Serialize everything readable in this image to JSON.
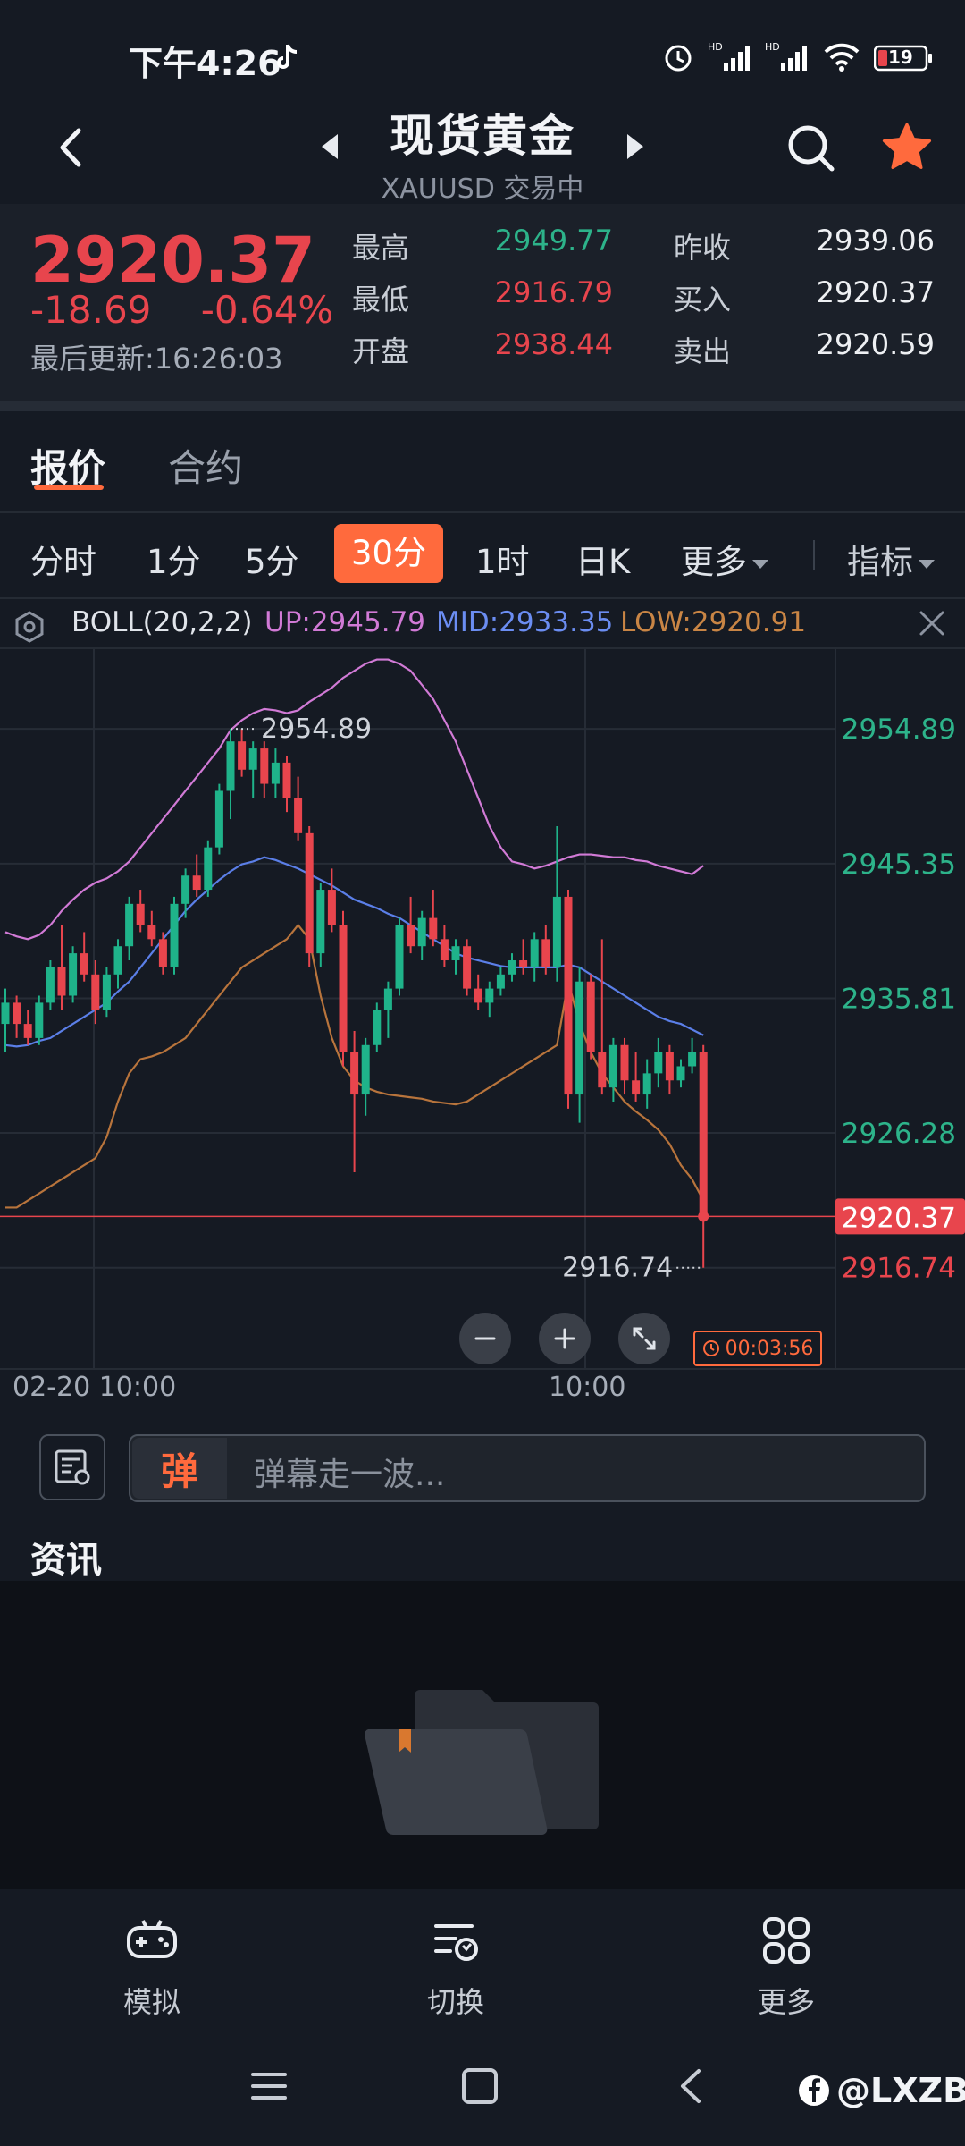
{
  "status_bar": {
    "time": "下午4:26",
    "battery": "19"
  },
  "header": {
    "title": "现货黄金",
    "subtitle": "XAUUSD 交易中"
  },
  "quote": {
    "price": "2920.37",
    "change": "-18.69",
    "change_pct": "-0.64%",
    "last_update": "最后更新:16:26:03",
    "high_label": "最高",
    "high": "2949.77",
    "low_label": "最低",
    "low": "2916.79",
    "open_label": "开盘",
    "open": "2938.44",
    "prev_close_label": "昨收",
    "prev_close": "2939.06",
    "buy_label": "买入",
    "buy": "2920.37",
    "sell_label": "卖出",
    "sell": "2920.59"
  },
  "tabs": [
    "报价",
    "合约"
  ],
  "periods": [
    "分时",
    "1分",
    "5分",
    "30分",
    "1时",
    "日K",
    "更多"
  ],
  "active_period": "30分",
  "indicator_menu": "指标",
  "indicator": {
    "name": "BOLL(20,2,2)",
    "up": "UP:2945.79",
    "mid": "MID:2933.35",
    "low": "LOW:2920.91"
  },
  "chart_data": {
    "type": "candlestick",
    "y_ticks": [
      "2954.89",
      "2945.35",
      "2935.81",
      "2926.28",
      "2916.74"
    ],
    "current_price_tag": "2920.37",
    "max_annotation": "2954.89",
    "min_annotation": "2916.74",
    "x_labels": [
      "02-20 10:00",
      "10:00"
    ],
    "ylim": [
      2914,
      2958
    ],
    "timer": "00:03:56",
    "colors": {
      "up": "#e8454d",
      "down": "#1fb38a",
      "boll_up": "#d17ad6",
      "boll_mid": "#5b7fe8",
      "boll_low": "#b8743c"
    },
    "candles": [
      {
        "o": 2934.0,
        "h": 2936.5,
        "l": 2932.0,
        "c": 2935.5
      },
      {
        "o": 2935.5,
        "h": 2936.0,
        "l": 2933.0,
        "c": 2934.0
      },
      {
        "o": 2934.0,
        "h": 2935.0,
        "l": 2932.5,
        "c": 2933.0
      },
      {
        "o": 2933.0,
        "h": 2936.0,
        "l": 2932.5,
        "c": 2935.5
      },
      {
        "o": 2935.5,
        "h": 2938.5,
        "l": 2935.0,
        "c": 2938.0
      },
      {
        "o": 2938.0,
        "h": 2941.0,
        "l": 2935.0,
        "c": 2936.0
      },
      {
        "o": 2936.0,
        "h": 2939.5,
        "l": 2935.5,
        "c": 2939.0
      },
      {
        "o": 2939.0,
        "h": 2940.5,
        "l": 2937.0,
        "c": 2937.5
      },
      {
        "o": 2937.5,
        "h": 2938.5,
        "l": 2934.0,
        "c": 2935.0
      },
      {
        "o": 2935.0,
        "h": 2938.0,
        "l": 2934.5,
        "c": 2937.5
      },
      {
        "o": 2937.5,
        "h": 2940.0,
        "l": 2936.5,
        "c": 2939.5
      },
      {
        "o": 2939.5,
        "h": 2943.0,
        "l": 2938.5,
        "c": 2942.5
      },
      {
        "o": 2942.5,
        "h": 2943.5,
        "l": 2940.5,
        "c": 2941.0
      },
      {
        "o": 2941.0,
        "h": 2942.0,
        "l": 2939.5,
        "c": 2940.0
      },
      {
        "o": 2940.0,
        "h": 2940.5,
        "l": 2937.5,
        "c": 2938.0
      },
      {
        "o": 2938.0,
        "h": 2943.0,
        "l": 2937.5,
        "c": 2942.5
      },
      {
        "o": 2942.5,
        "h": 2945.0,
        "l": 2941.5,
        "c": 2944.5
      },
      {
        "o": 2944.5,
        "h": 2946.0,
        "l": 2943.0,
        "c": 2943.5
      },
      {
        "o": 2943.5,
        "h": 2947.0,
        "l": 2943.0,
        "c": 2946.5
      },
      {
        "o": 2946.5,
        "h": 2951.0,
        "l": 2946.0,
        "c": 2950.5
      },
      {
        "o": 2950.5,
        "h": 2954.89,
        "l": 2948.5,
        "c": 2954.0
      },
      {
        "o": 2954.0,
        "h": 2954.89,
        "l": 2951.5,
        "c": 2952.0
      },
      {
        "o": 2952.0,
        "h": 2954.0,
        "l": 2950.0,
        "c": 2953.5
      },
      {
        "o": 2953.5,
        "h": 2954.0,
        "l": 2950.0,
        "c": 2951.0
      },
      {
        "o": 2951.0,
        "h": 2953.5,
        "l": 2950.0,
        "c": 2952.5
      },
      {
        "o": 2952.5,
        "h": 2953.0,
        "l": 2949.0,
        "c": 2950.0
      },
      {
        "o": 2950.0,
        "h": 2951.5,
        "l": 2947.0,
        "c": 2947.5
      },
      {
        "o": 2947.5,
        "h": 2948.0,
        "l": 2938.0,
        "c": 2939.0
      },
      {
        "o": 2939.0,
        "h": 2944.0,
        "l": 2938.0,
        "c": 2943.5
      },
      {
        "o": 2943.5,
        "h": 2945.0,
        "l": 2940.5,
        "c": 2941.0
      },
      {
        "o": 2941.0,
        "h": 2942.0,
        "l": 2931.0,
        "c": 2932.0
      },
      {
        "o": 2932.0,
        "h": 2933.5,
        "l": 2923.5,
        "c": 2929.0
      },
      {
        "o": 2929.0,
        "h": 2933.0,
        "l": 2927.5,
        "c": 2932.5
      },
      {
        "o": 2932.5,
        "h": 2935.5,
        "l": 2932.0,
        "c": 2935.0
      },
      {
        "o": 2935.0,
        "h": 2937.0,
        "l": 2933.0,
        "c": 2936.5
      },
      {
        "o": 2936.5,
        "h": 2941.5,
        "l": 2936.0,
        "c": 2941.0
      },
      {
        "o": 2941.0,
        "h": 2943.0,
        "l": 2939.0,
        "c": 2939.5
      },
      {
        "o": 2939.5,
        "h": 2942.0,
        "l": 2938.5,
        "c": 2941.5
      },
      {
        "o": 2941.5,
        "h": 2943.5,
        "l": 2939.5,
        "c": 2940.0
      },
      {
        "o": 2940.0,
        "h": 2941.0,
        "l": 2938.0,
        "c": 2938.5
      },
      {
        "o": 2938.5,
        "h": 2940.0,
        "l": 2937.5,
        "c": 2939.5
      },
      {
        "o": 2939.5,
        "h": 2940.0,
        "l": 2936.0,
        "c": 2936.5
      },
      {
        "o": 2936.5,
        "h": 2937.5,
        "l": 2935.0,
        "c": 2935.5
      },
      {
        "o": 2935.5,
        "h": 2937.0,
        "l": 2934.5,
        "c": 2936.5
      },
      {
        "o": 2936.5,
        "h": 2938.0,
        "l": 2936.0,
        "c": 2937.5
      },
      {
        "o": 2937.5,
        "h": 2939.0,
        "l": 2937.0,
        "c": 2938.5
      },
      {
        "o": 2938.5,
        "h": 2940.0,
        "l": 2937.5,
        "c": 2938.0
      },
      {
        "o": 2938.0,
        "h": 2940.5,
        "l": 2937.0,
        "c": 2940.0
      },
      {
        "o": 2940.0,
        "h": 2941.0,
        "l": 2937.5,
        "c": 2938.0
      },
      {
        "o": 2938.0,
        "h": 2948.0,
        "l": 2937.0,
        "c": 2943.0
      },
      {
        "o": 2943.0,
        "h": 2943.5,
        "l": 2928.0,
        "c": 2929.0
      },
      {
        "o": 2929.0,
        "h": 2938.0,
        "l": 2927.0,
        "c": 2937.0
      },
      {
        "o": 2937.0,
        "h": 2937.5,
        "l": 2931.5,
        "c": 2932.0
      },
      {
        "o": 2932.0,
        "h": 2940.0,
        "l": 2929.0,
        "c": 2929.5
      },
      {
        "o": 2929.5,
        "h": 2933.0,
        "l": 2928.5,
        "c": 2932.5
      },
      {
        "o": 2932.5,
        "h": 2933.0,
        "l": 2929.0,
        "c": 2930.0
      },
      {
        "o": 2930.0,
        "h": 2932.0,
        "l": 2928.5,
        "c": 2929.0
      },
      {
        "o": 2929.0,
        "h": 2931.5,
        "l": 2928.0,
        "c": 2930.5
      },
      {
        "o": 2930.5,
        "h": 2933.0,
        "l": 2929.5,
        "c": 2932.0
      },
      {
        "o": 2932.0,
        "h": 2932.5,
        "l": 2929.0,
        "c": 2930.0
      },
      {
        "o": 2930.0,
        "h": 2931.5,
        "l": 2929.5,
        "c": 2931.0
      },
      {
        "o": 2931.0,
        "h": 2933.0,
        "l": 2930.5,
        "c": 2932.0
      },
      {
        "o": 2932.0,
        "h": 2932.5,
        "l": 2916.74,
        "c": 2920.37
      }
    ],
    "boll_up": [
      2940.5,
      2940.2,
      2940.0,
      2940.3,
      2941.0,
      2942.0,
      2942.8,
      2943.5,
      2944.0,
      2944.3,
      2944.8,
      2945.5,
      2946.5,
      2947.5,
      2948.5,
      2949.5,
      2950.5,
      2951.5,
      2952.5,
      2953.5,
      2954.8,
      2955.5,
      2956.0,
      2956.3,
      2956.2,
      2956.0,
      2956.2,
      2956.8,
      2957.3,
      2957.8,
      2958.5,
      2959.0,
      2959.5,
      2959.8,
      2959.8,
      2959.5,
      2959.0,
      2958.0,
      2957.0,
      2955.5,
      2954.0,
      2952.0,
      2950.0,
      2948.0,
      2946.5,
      2945.5,
      2945.3,
      2945.0,
      2945.2,
      2945.5,
      2945.8,
      2946.0,
      2946.0,
      2945.9,
      2945.8,
      2945.8,
      2945.6,
      2945.5,
      2945.2,
      2945.0,
      2944.8,
      2944.6,
      2945.2
    ],
    "boll_mid": [
      2932.5,
      2932.4,
      2932.5,
      2932.8,
      2933.0,
      2933.5,
      2934.0,
      2934.5,
      2935.0,
      2935.5,
      2936.3,
      2937.0,
      2938.0,
      2939.0,
      2940.0,
      2941.0,
      2942.0,
      2942.8,
      2943.5,
      2944.2,
      2944.8,
      2945.3,
      2945.5,
      2945.8,
      2945.6,
      2945.3,
      2945.0,
      2944.6,
      2944.2,
      2943.8,
      2943.3,
      2942.8,
      2942.5,
      2942.2,
      2941.8,
      2941.5,
      2941.0,
      2940.5,
      2940.0,
      2939.5,
      2939.0,
      2938.7,
      2938.5,
      2938.3,
      2938.1,
      2938.0,
      2938.0,
      2938.0,
      2938.0,
      2938.0,
      2938.2,
      2938.0,
      2937.5,
      2937.0,
      2936.5,
      2936.0,
      2935.5,
      2935.0,
      2934.5,
      2934.2,
      2934.0,
      2933.6,
      2933.2
    ],
    "boll_low": [
      2921.0,
      2921.0,
      2921.5,
      2922.0,
      2922.5,
      2923.0,
      2923.5,
      2924.0,
      2924.5,
      2926.0,
      2928.5,
      2930.5,
      2931.5,
      2931.7,
      2932.0,
      2932.5,
      2933.0,
      2934.0,
      2935.0,
      2936.0,
      2937.0,
      2938.0,
      2938.5,
      2939.0,
      2939.5,
      2940.0,
      2941.0,
      2940.0,
      2936.0,
      2933.0,
      2931.0,
      2930.0,
      2929.5,
      2929.2,
      2929.0,
      2928.9,
      2928.8,
      2928.7,
      2928.5,
      2928.4,
      2928.3,
      2928.5,
      2929.0,
      2929.5,
      2930.0,
      2930.5,
      2931.0,
      2931.5,
      2932.0,
      2932.5,
      2937.0,
      2934.0,
      2932.0,
      2930.5,
      2929.5,
      2928.5,
      2927.8,
      2927.2,
      2926.5,
      2925.5,
      2924.0,
      2923.0,
      2921.5
    ]
  },
  "danmu": {
    "badge": "弹",
    "placeholder": "弹幕走一波..."
  },
  "news_title": "资讯",
  "bottom_nav": {
    "simulate": "模拟",
    "switch": "切换",
    "more": "更多"
  },
  "watermark": "@LXZB"
}
